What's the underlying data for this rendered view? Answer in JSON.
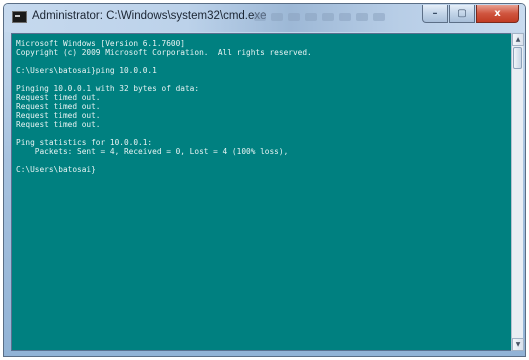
{
  "window": {
    "title": "Administrator: C:\\Windows\\system32\\cmd.exe",
    "controls": {
      "minimize": "–",
      "maximize": "▢",
      "close": "x"
    }
  },
  "console": {
    "background": "#008080",
    "text_color": "#e8f4f4",
    "lines": [
      "Microsoft Windows [Version 6.1.7600]",
      "Copyright (c) 2009 Microsoft Corporation.  All rights reserved.",
      "",
      "C:\\Users\\batosai}ping 10.0.0.1",
      "",
      "Pinging 10.0.0.1 with 32 bytes of data:",
      "Request timed out.",
      "Request timed out.",
      "Request timed out.",
      "Request timed out.",
      "",
      "Ping statistics for 10.0.0.1:",
      "    Packets: Sent = 4, Received = 0, Lost = 4 (100% loss),",
      "",
      "C:\\Users\\batosai}"
    ]
  },
  "scrollbar": {
    "up_arrow": "▲",
    "down_arrow": "▼"
  }
}
